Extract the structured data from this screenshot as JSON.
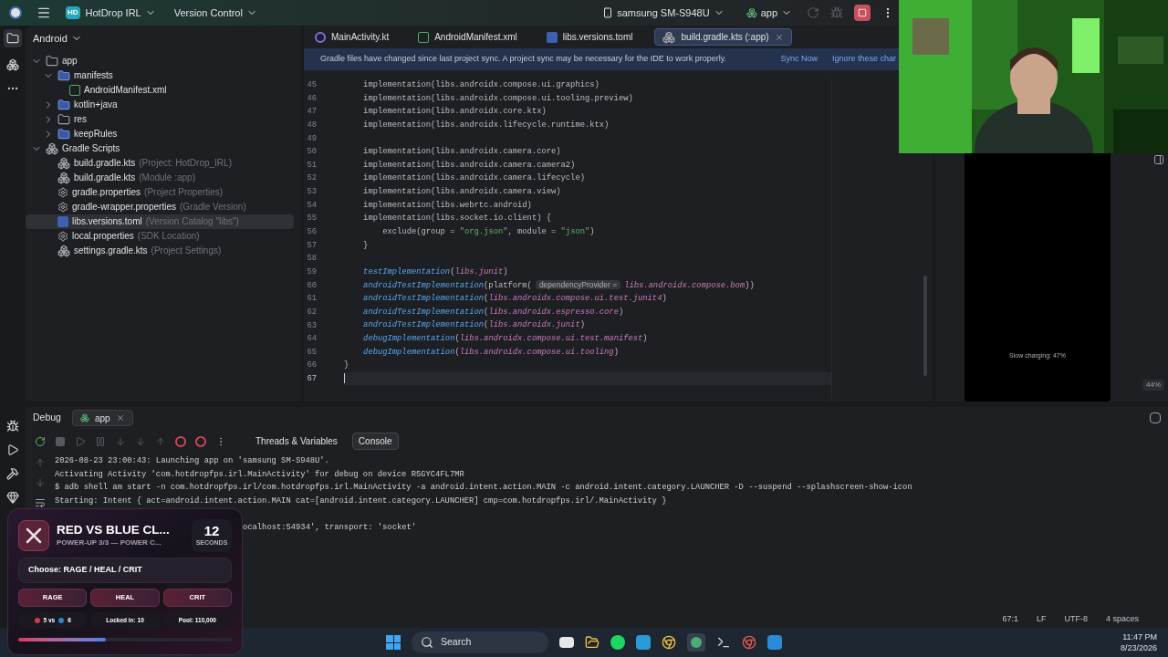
{
  "toolbar": {
    "project_badge": "HD",
    "project": "HotDrop IRL",
    "version_control": "Version Control",
    "device": "samsung SM-S948U",
    "run_config": "app"
  },
  "project_panel": {
    "title": "Android",
    "tree": [
      {
        "label": "app",
        "kind": "module",
        "expanded": true,
        "selected": false,
        "children": [
          {
            "label": "manifests",
            "kind": "folder",
            "expanded": true,
            "selected": false,
            "children": [
              {
                "label": "AndroidManifest.xml",
                "kind": "manifest",
                "selected": false
              }
            ]
          },
          {
            "label": "kotlin+java",
            "kind": "folder",
            "expanded": false,
            "selected": false
          },
          {
            "label": "res",
            "kind": "res",
            "expanded": false,
            "selected": false
          },
          {
            "label": "keepRules",
            "kind": "folder",
            "expanded": false,
            "selected": false
          }
        ]
      },
      {
        "label": "Gradle Scripts",
        "kind": "scripts",
        "expanded": true,
        "selected": false,
        "children": [
          {
            "label": "build.gradle.kts",
            "hint": "(Project: HotDrop_IRL)",
            "kind": "gradle",
            "selected": false
          },
          {
            "label": "build.gradle.kts",
            "hint": "(Module :app)",
            "kind": "gradle",
            "selected": false
          },
          {
            "label": "gradle.properties",
            "hint": "(Project Properties)",
            "kind": "settings",
            "selected": false
          },
          {
            "label": "gradle-wrapper.properties",
            "hint": "(Gradle Version)",
            "kind": "settings",
            "selected": false
          },
          {
            "label": "libs.versions.toml",
            "hint": "(Version Catalog \"libs\")",
            "kind": "toml",
            "selected": true
          },
          {
            "label": "local.properties",
            "hint": "(SDK Location)",
            "kind": "settings",
            "selected": false
          },
          {
            "label": "settings.gradle.kts",
            "hint": "(Project Settings)",
            "kind": "gradle",
            "selected": false
          }
        ]
      }
    ]
  },
  "editor_tabs": [
    {
      "label": "MainActivity.kt",
      "kind": "kotlin",
      "selected": false
    },
    {
      "label": "AndroidManifest.xml",
      "kind": "manifest",
      "selected": false
    },
    {
      "label": "libs.versions.toml",
      "kind": "toml",
      "selected": false
    },
    {
      "label": "build.gradle.kts (:app)",
      "kind": "gradle",
      "selected": true
    }
  ],
  "banner": {
    "message": "Gradle files have changed since last project sync. A project sync may be necessary for the IDE to work properly.",
    "sync": "Sync Now",
    "ignore": "Ignore these char"
  },
  "code": [
    {
      "n": "45",
      "segments": [
        {
          "kind": "plain",
          "text": "    implementation(libs.androidx.compose.ui.graphics)"
        }
      ]
    },
    {
      "n": "46",
      "segments": [
        {
          "kind": "plain",
          "text": "    implementation(libs.androidx.compose.ui.tooling.preview)"
        }
      ]
    },
    {
      "n": "47",
      "segments": [
        {
          "kind": "plain",
          "text": "    implementation(libs.androidx.core.ktx)"
        }
      ]
    },
    {
      "n": "48",
      "segments": [
        {
          "kind": "plain",
          "text": "    implementation(libs.androidx.lifecycle.runtime.ktx)"
        }
      ]
    },
    {
      "n": "49"
    },
    {
      "n": "50",
      "segments": [
        {
          "kind": "plain",
          "text": "    implementation(libs.androidx.camera.core)"
        }
      ]
    },
    {
      "n": "51",
      "segments": [
        {
          "kind": "plain",
          "text": "    implementation(libs.androidx.camera.camera2)"
        }
      ]
    },
    {
      "n": "52",
      "segments": [
        {
          "kind": "plain",
          "text": "    implementation(libs.androidx.camera.lifecycle)"
        }
      ]
    },
    {
      "n": "53",
      "segments": [
        {
          "kind": "plain",
          "text": "    implementation(libs.androidx.camera.view)"
        }
      ]
    },
    {
      "n": "54",
      "segments": [
        {
          "kind": "plain",
          "text": "    implementation(libs.webrtc.android)"
        }
      ]
    },
    {
      "n": "55",
      "segments": [
        {
          "kind": "plain",
          "text": "    implementation(libs.socket.io.client) {"
        }
      ]
    },
    {
      "n": "56",
      "segments": [
        {
          "kind": "plain",
          "text": "        exclude(group = "
        },
        {
          "kind": "str",
          "text": "\"org.json\""
        },
        {
          "kind": "plain",
          "text": ", module = "
        },
        {
          "kind": "str",
          "text": "\"json\""
        },
        {
          "kind": "plain",
          "text": ")"
        }
      ]
    },
    {
      "n": "57",
      "segments": [
        {
          "kind": "plain",
          "text": "    }"
        }
      ]
    },
    {
      "n": "58"
    },
    {
      "n": "59",
      "segments": [
        {
          "kind": "fn",
          "text": "    testImplementation"
        },
        {
          "kind": "plain",
          "text": "("
        },
        {
          "kind": "ref",
          "text": "libs.junit"
        },
        {
          "kind": "plain",
          "text": ")"
        }
      ]
    },
    {
      "n": "60",
      "segments": [
        {
          "kind": "fn",
          "text": "    androidTestImplementation"
        },
        {
          "kind": "plain",
          "text": "(platform("
        },
        {
          "kind": "hint",
          "text": "dependencyProvider ="
        },
        {
          "kind": "ref",
          "text": "libs.androidx.compose.bom"
        },
        {
          "kind": "plain",
          "text": "))"
        }
      ]
    },
    {
      "n": "61",
      "segments": [
        {
          "kind": "fn",
          "text": "    androidTestImplementation"
        },
        {
          "kind": "plain",
          "text": "("
        },
        {
          "kind": "ref",
          "text": "libs.androidx.compose.ui.test.junit4"
        },
        {
          "kind": "plain",
          "text": ")"
        }
      ]
    },
    {
      "n": "62",
      "segments": [
        {
          "kind": "fn",
          "text": "    androidTestImplementation"
        },
        {
          "kind": "plain",
          "text": "("
        },
        {
          "kind": "ref",
          "text": "libs.androidx.espresso.core"
        },
        {
          "kind": "plain",
          "text": ")"
        }
      ]
    },
    {
      "n": "63",
      "segments": [
        {
          "kind": "fn",
          "text": "    androidTestImplementation"
        },
        {
          "kind": "plain",
          "text": "("
        },
        {
          "kind": "ref",
          "text": "libs.androidx.junit"
        },
        {
          "kind": "plain",
          "text": ")"
        }
      ]
    },
    {
      "n": "64",
      "segments": [
        {
          "kind": "fn",
          "text": "    debugImplementation"
        },
        {
          "kind": "plain",
          "text": "("
        },
        {
          "kind": "ref",
          "text": "libs.androidx.compose.ui.test.manifest"
        },
        {
          "kind": "plain",
          "text": ")"
        }
      ]
    },
    {
      "n": "65",
      "segments": [
        {
          "kind": "fn",
          "text": "    debugImplementation"
        },
        {
          "kind": "plain",
          "text": "("
        },
        {
          "kind": "ref",
          "text": "libs.androidx.compose.ui.tooling"
        },
        {
          "kind": "plain",
          "text": ")"
        }
      ]
    },
    {
      "n": "66",
      "segments": [
        {
          "kind": "plain",
          "text": "}"
        }
      ]
    },
    {
      "n": "67"
    }
  ],
  "emulator": {
    "status": "Slow charging: 47%",
    "zoom": "44%"
  },
  "debug": {
    "title": "Debug",
    "session": "app",
    "tabs": [
      {
        "label": "Threads & Variables",
        "selected": false
      },
      {
        "label": "Console",
        "selected": true
      }
    ],
    "console": [
      "2026-08-23 23:00:43: Launching app on 'samsung SM-S948U'.",
      "Activating Activity 'com.hotdropfps.irl.MainActivity' for debug on device R5GYC4FL7MR",
      "$ adb shell am start -n com.hotdropfps.irl/com.hotdropfps.irl.MainActivity -a android.intent.action.MAIN -c android.intent.category.LAUNCHER -D --suspend --splashscreen-show-icon",
      "Starting: Intent { act=android.intent.action.MAIN cat=[android.intent.category.LAUNCHER] cmp=com.hotdropfps.irl/.MainActivity }"
    ],
    "console_partial": "ocalhost:54934', transport: 'socket'"
  },
  "status_bar": [
    "67:1",
    "LF",
    "UTF-8",
    "4 spaces"
  ],
  "game_card": {
    "title": "RED VS BLUE CL...",
    "subtitle": "POWER-UP 3/3 — POWER C...",
    "count": "12",
    "count_unit": "SECONDS",
    "prompt": "Choose: RAGE / HEAL / CRIT",
    "choices": [
      "RAGE",
      "HEAL",
      "CRIT"
    ],
    "teams": [
      {
        "label": "5 vs",
        "color": "#e0334f"
      },
      {
        "label": "6",
        "color": "#2f86c9"
      }
    ],
    "locked": "Locked in: 10",
    "pool": "Pool: 110,000",
    "level": 0.41
  },
  "taskbar": {
    "search": "Search",
    "time": "11:47 PM",
    "date": "8/23/2026"
  }
}
